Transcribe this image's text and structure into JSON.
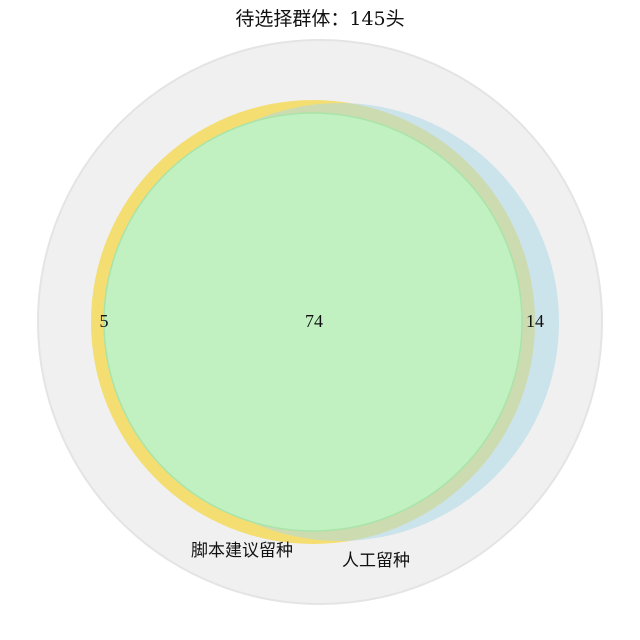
{
  "diagram": {
    "title": "待选择群体：145头",
    "colors": {
      "universe_fill": "#f0f0f0",
      "universe_stroke": "#e4e4e4",
      "script_set_fill": "#f5d63b",
      "manual_set_fill": "#add8e6",
      "intersection_fill": "#c1f0c1",
      "intersection_stroke": "#a9e4a9"
    },
    "sets": {
      "script": {
        "label": "脚本建议留种",
        "only_count": "5"
      },
      "manual": {
        "label": "人工留种",
        "only_count": "14"
      }
    },
    "intersection_count": "74"
  }
}
